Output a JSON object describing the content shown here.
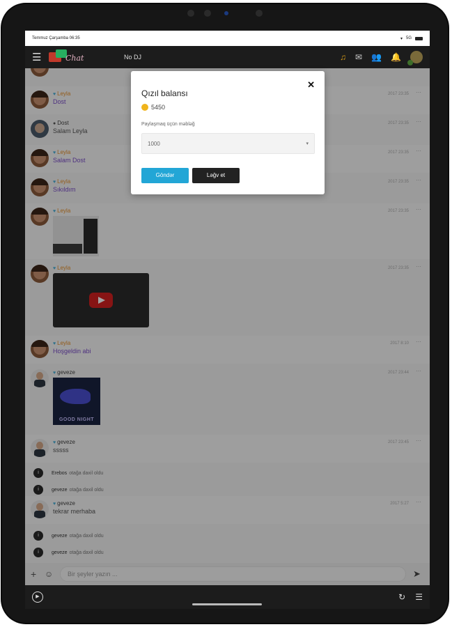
{
  "status_bar": {
    "datetime": "Temmuz Çarşamba 06:35",
    "network": "5G"
  },
  "header": {
    "dj_label": "No DJ"
  },
  "messages": [
    {
      "user": "Leyla",
      "text": "Dost",
      "time": "2017 23:35"
    },
    {
      "user": "Dost",
      "text": "Salam Leyla",
      "time": "2017 23:35"
    },
    {
      "user": "Leyla",
      "text": "Salam Dost",
      "time": "2017 23:35"
    },
    {
      "user": "Leyla",
      "text": "Sıkıldım",
      "time": "2017 23:35"
    },
    {
      "user": "Leyla",
      "time": "2017 23:35"
    },
    {
      "user": "Leyla",
      "time": "2017 23:35"
    },
    {
      "user": "Leyla",
      "text": "Hoşgeldin abi",
      "time": "2017 8:10"
    },
    {
      "user": "geveze",
      "time": "2017 23:44",
      "image_caption": "GOOD NIGHT"
    },
    {
      "user": "geveze",
      "text": "sssss",
      "time": "2017 23:45"
    },
    {
      "user": "geveze",
      "text": "tekrar merhaba",
      "time": "2017 5:27"
    }
  ],
  "system_messages": [
    {
      "name": "Erebos",
      "text": "otağa daxil oldu"
    },
    {
      "name": "geveze",
      "text": "otağa daxil oldu"
    },
    {
      "name": "geveze",
      "text": "otağa daxil oldu"
    },
    {
      "name": "geveze",
      "text": "otağa daxil oldu"
    }
  ],
  "composer": {
    "placeholder": "Bir şeyler yazın ..."
  },
  "modal": {
    "title": "Qızıl balansı",
    "balance": "5450",
    "amount_label": "Paylaşmaq üçün məbləğ",
    "amount_value": "1000",
    "send_label": "Göndər",
    "cancel_label": "Ləğv et"
  },
  "colors": {
    "accent": "#22a6d6",
    "username": "#e6902a",
    "message_text": "#7a4cc8",
    "topbar": "#1c1c1c"
  },
  "icons": {
    "menu": "hamburger-icon",
    "music": "music-note-icon",
    "mail": "envelope-icon",
    "friends": "user-add-icon",
    "notification": "bell-icon",
    "close": "close-icon",
    "send": "paper-plane-icon",
    "emoji": "smile-icon",
    "add": "plus-icon",
    "play": "play-icon",
    "refresh": "refresh-icon"
  }
}
